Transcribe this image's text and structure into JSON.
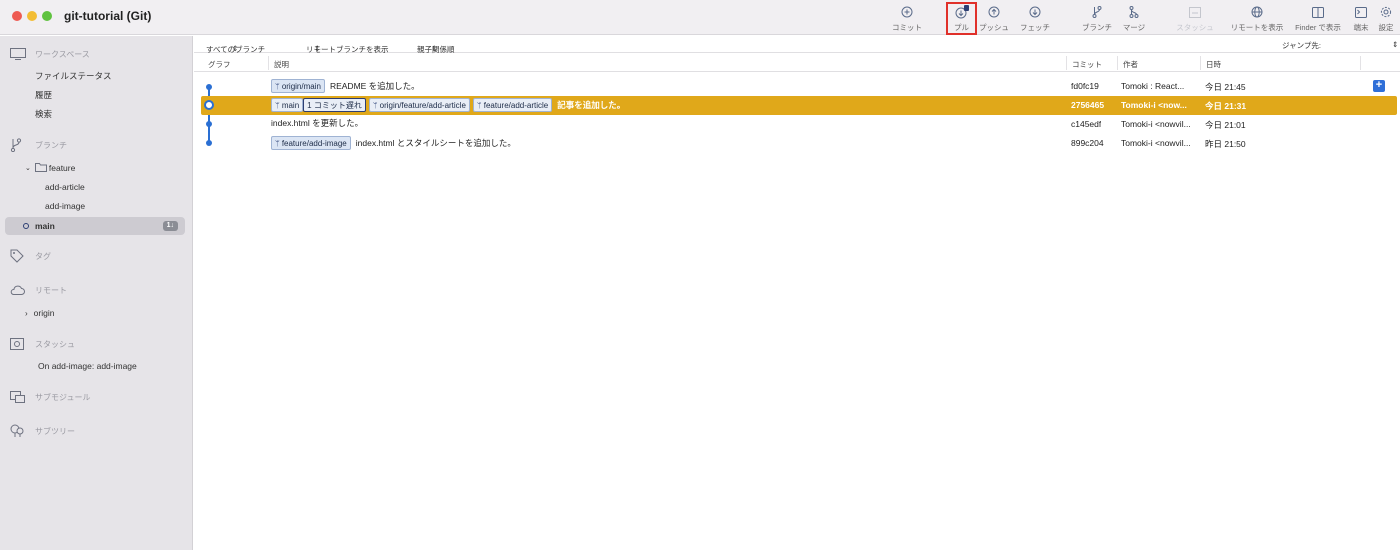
{
  "window": {
    "title": "git-tutorial (Git)"
  },
  "toolbar": {
    "commit": "コミット",
    "pull": "プル",
    "push": "プッシュ",
    "fetch": "フェッチ",
    "branch": "ブランチ",
    "merge": "マージ",
    "stash": "スタッシュ",
    "show_remote": "リモートを表示",
    "show_in_finder": "Finder で表示",
    "terminal": "端末",
    "settings": "設定"
  },
  "sidebar": {
    "workspace": "ワークスペース",
    "file_status": "ファイルステータス",
    "history": "履歴",
    "search": "検索",
    "branches": "ブランチ",
    "folder_feature": "feature",
    "add_article": "add-article",
    "add_image": "add-image",
    "main": "main",
    "main_badge": "1↓",
    "tags": "タグ",
    "remotes": "リモート",
    "origin": "origin",
    "stash_section": "スタッシュ",
    "stash_item": "On add-image: add-image",
    "submodules": "サブモジュール",
    "subtrees": "サブツリー"
  },
  "filters": {
    "all_branches": "すべてのブランチ",
    "show_remote_branches": "リモートブランチを表示",
    "ancestor_order": "親子関係順",
    "jump_to": "ジャンプ先:"
  },
  "columns": {
    "graph": "グラフ",
    "description": "説明",
    "commit": "コミット",
    "author": "作者",
    "date": "日時"
  },
  "commits": [
    {
      "tags": [
        "origin/main"
      ],
      "message": "README を追加した。",
      "hash": "fd0fc19",
      "author": "Tomoki : React...",
      "date": "今日 21:45"
    },
    {
      "tags": [
        "main",
        "1 コミット遅れ",
        "origin/feature/add-article",
        "feature/add-article"
      ],
      "message": "記事を追加した。",
      "hash": "2756465",
      "author": "Tomoki-i <now...",
      "date": "今日 21:31"
    },
    {
      "tags": [],
      "message": "index.html を更新した。",
      "hash": "c145edf",
      "author": "Tomoki-i <nowvil...",
      "date": "今日 21:01"
    },
    {
      "tags": [
        "feature/add-image"
      ],
      "message": "index.html とスタイルシートを追加した。",
      "hash": "899c204",
      "author": "Tomoki-i <nowvil...",
      "date": "昨日 21:50"
    }
  ],
  "colors": {
    "selection": "#e0a81a",
    "graph": "#2a6fd3",
    "highlight_box": "#e0302a"
  },
  "icons": [
    "commit-icon",
    "pull-icon",
    "push-icon",
    "fetch-icon",
    "branch-icon",
    "merge-icon",
    "stash-icon",
    "globe-icon",
    "finder-icon",
    "terminal-icon",
    "gear-icon"
  ]
}
